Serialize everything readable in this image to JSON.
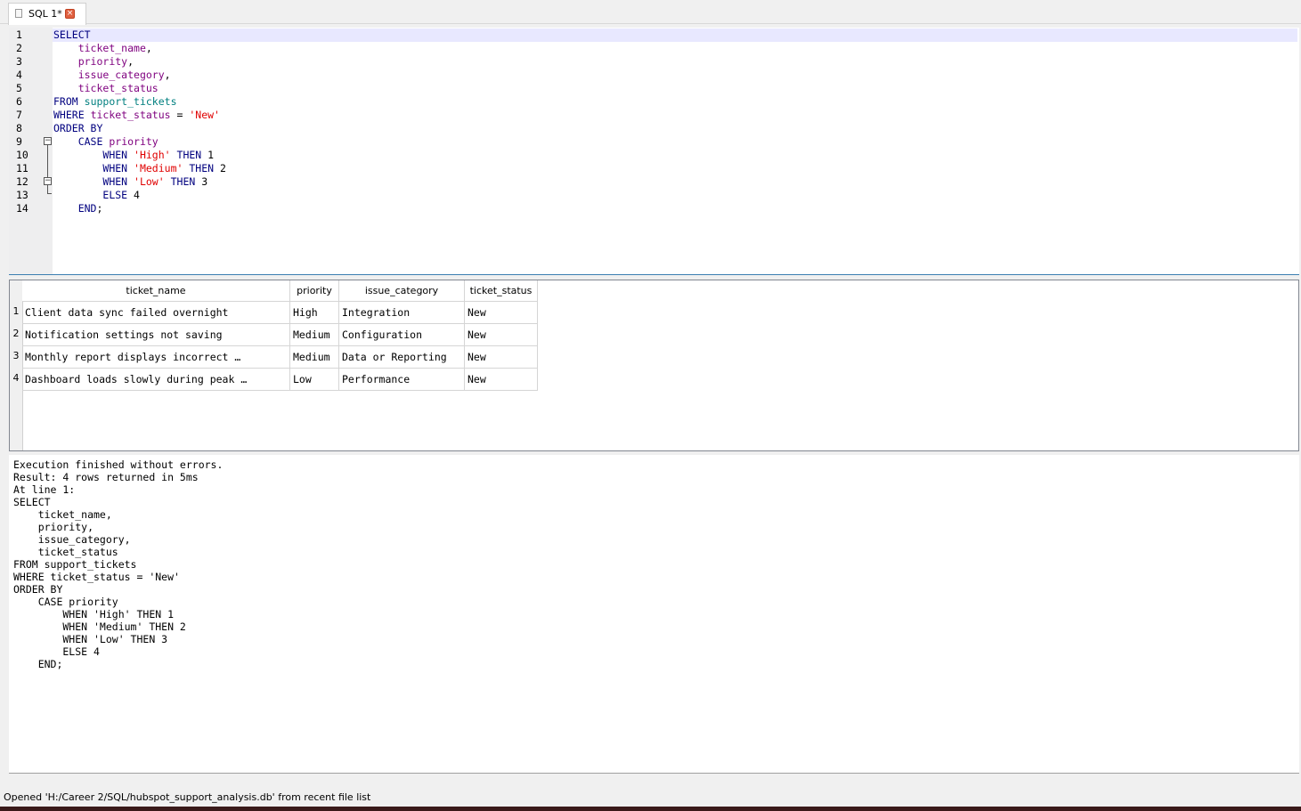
{
  "tab": {
    "label": "SQL 1*"
  },
  "editor": {
    "lines": [
      {
        "num": "1",
        "html": "<span class='kw'>SELECT</span>"
      },
      {
        "num": "2",
        "html": "    <span class='id'>ticket_name</span>,"
      },
      {
        "num": "3",
        "html": "    <span class='id'>priority</span>,"
      },
      {
        "num": "4",
        "html": "    <span class='id'>issue_category</span>,"
      },
      {
        "num": "5",
        "html": "    <span class='id'>ticket_status</span>"
      },
      {
        "num": "6",
        "html": "<span class='kw'>FROM</span> <span class='tbl'>support_tickets</span>"
      },
      {
        "num": "7",
        "html": "<span class='kw'>WHERE</span> <span class='id'>ticket_status</span> = <span class='str'>'New'</span>"
      },
      {
        "num": "8",
        "html": "<span class='kw'>ORDER BY</span>"
      },
      {
        "num": "9",
        "html": "    <span class='kw'>CASE</span> <span class='id'>priority</span>"
      },
      {
        "num": "10",
        "html": "        <span class='kw'>WHEN</span> <span class='str'>'High'</span> <span class='kw'>THEN</span> 1"
      },
      {
        "num": "11",
        "html": "        <span class='kw'>WHEN</span> <span class='str'>'Medium'</span> <span class='kw'>THEN</span> 2"
      },
      {
        "num": "12",
        "html": "        <span class='kw'>WHEN</span> <span class='str'>'Low'</span> <span class='kw'>THEN</span> 3"
      },
      {
        "num": "13",
        "html": "        <span class='kw'>ELSE</span> 4"
      },
      {
        "num": "14",
        "html": "    <span class='kw'>END</span>;"
      }
    ]
  },
  "results": {
    "columns": [
      "ticket_name",
      "priority",
      "issue_category",
      "ticket_status"
    ],
    "rows": [
      {
        "num": "1",
        "cells": [
          "Client data sync failed overnight",
          "High",
          "Integration",
          "New"
        ]
      },
      {
        "num": "2",
        "cells": [
          "Notification settings not saving",
          "Medium",
          "Configuration",
          "New"
        ]
      },
      {
        "num": "3",
        "cells": [
          "Monthly report displays incorrect …",
          "Medium",
          "Data or Reporting",
          "New"
        ]
      },
      {
        "num": "4",
        "cells": [
          "Dashboard loads slowly during peak …",
          "Low",
          "Performance",
          "New"
        ]
      }
    ]
  },
  "output": {
    "text": "Execution finished without errors.\nResult: 4 rows returned in 5ms\nAt line 1:\nSELECT\n    ticket_name,\n    priority,\n    issue_category,\n    ticket_status\nFROM support_tickets\nWHERE ticket_status = 'New'\nORDER BY\n    CASE priority\n        WHEN 'High' THEN 1\n        WHEN 'Medium' THEN 2\n        WHEN 'Low' THEN 3\n        ELSE 4\n    END;"
  },
  "status": {
    "message": "Opened 'H:/Career 2/SQL/hubspot_support_analysis.db' from recent file list"
  }
}
